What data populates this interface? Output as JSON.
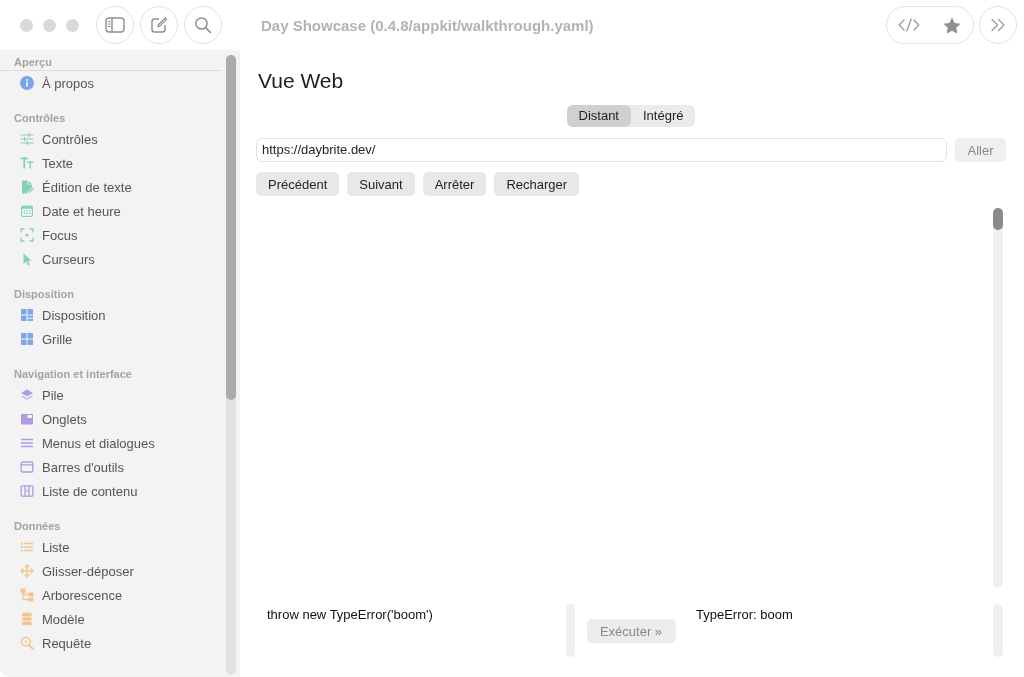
{
  "window": {
    "title": "Day Showcase (0.4.8/appkit/walkthrough.yaml)"
  },
  "sidebar": {
    "sections": [
      {
        "header": "Aperçu",
        "items": [
          {
            "label": "À propos",
            "selected": false
          }
        ]
      },
      {
        "header": "Contrôles",
        "items": [
          {
            "label": "Contrôles",
            "selected": false
          },
          {
            "label": "Texte",
            "selected": false
          },
          {
            "label": "Édition de texte",
            "selected": false
          },
          {
            "label": "Date et heure",
            "selected": false
          },
          {
            "label": "Focus",
            "selected": false
          },
          {
            "label": "Curseurs",
            "selected": false
          }
        ]
      },
      {
        "header": "Disposition",
        "items": [
          {
            "label": "Disposition",
            "selected": false
          },
          {
            "label": "Grille",
            "selected": false
          }
        ]
      },
      {
        "header": "Navigation et interface",
        "items": [
          {
            "label": "Pile",
            "selected": false
          },
          {
            "label": "Onglets",
            "selected": false
          },
          {
            "label": "Menus et dialogues",
            "selected": false
          },
          {
            "label": "Barres d'outils",
            "selected": false
          },
          {
            "label": "Liste de contenu",
            "selected": false
          }
        ]
      },
      {
        "header": "Données",
        "items": [
          {
            "label": "Liste",
            "selected": false
          },
          {
            "label": "Glisser-déposer",
            "selected": false
          },
          {
            "label": "Arborescence",
            "selected": false
          },
          {
            "label": "Modèle",
            "selected": false
          },
          {
            "label": "Requête",
            "selected": false
          }
        ]
      }
    ]
  },
  "page": {
    "title": "Vue Web",
    "segments": [
      {
        "label": "Distant",
        "selected": true
      },
      {
        "label": "Intégré",
        "selected": false
      }
    ],
    "url_field": {
      "value": "https://daybrite.dev/"
    },
    "go_button": {
      "label": "Aller",
      "disabled": true
    },
    "nav_buttons": [
      {
        "label": "Précédent"
      },
      {
        "label": "Suivant"
      },
      {
        "label": "Arrêter"
      },
      {
        "label": "Recharger"
      }
    ],
    "console": {
      "code": "throw new TypeError('boom')",
      "run_button": {
        "label": "Exécuter »",
        "disabled": true
      },
      "output": "TypeError: boom"
    }
  }
}
